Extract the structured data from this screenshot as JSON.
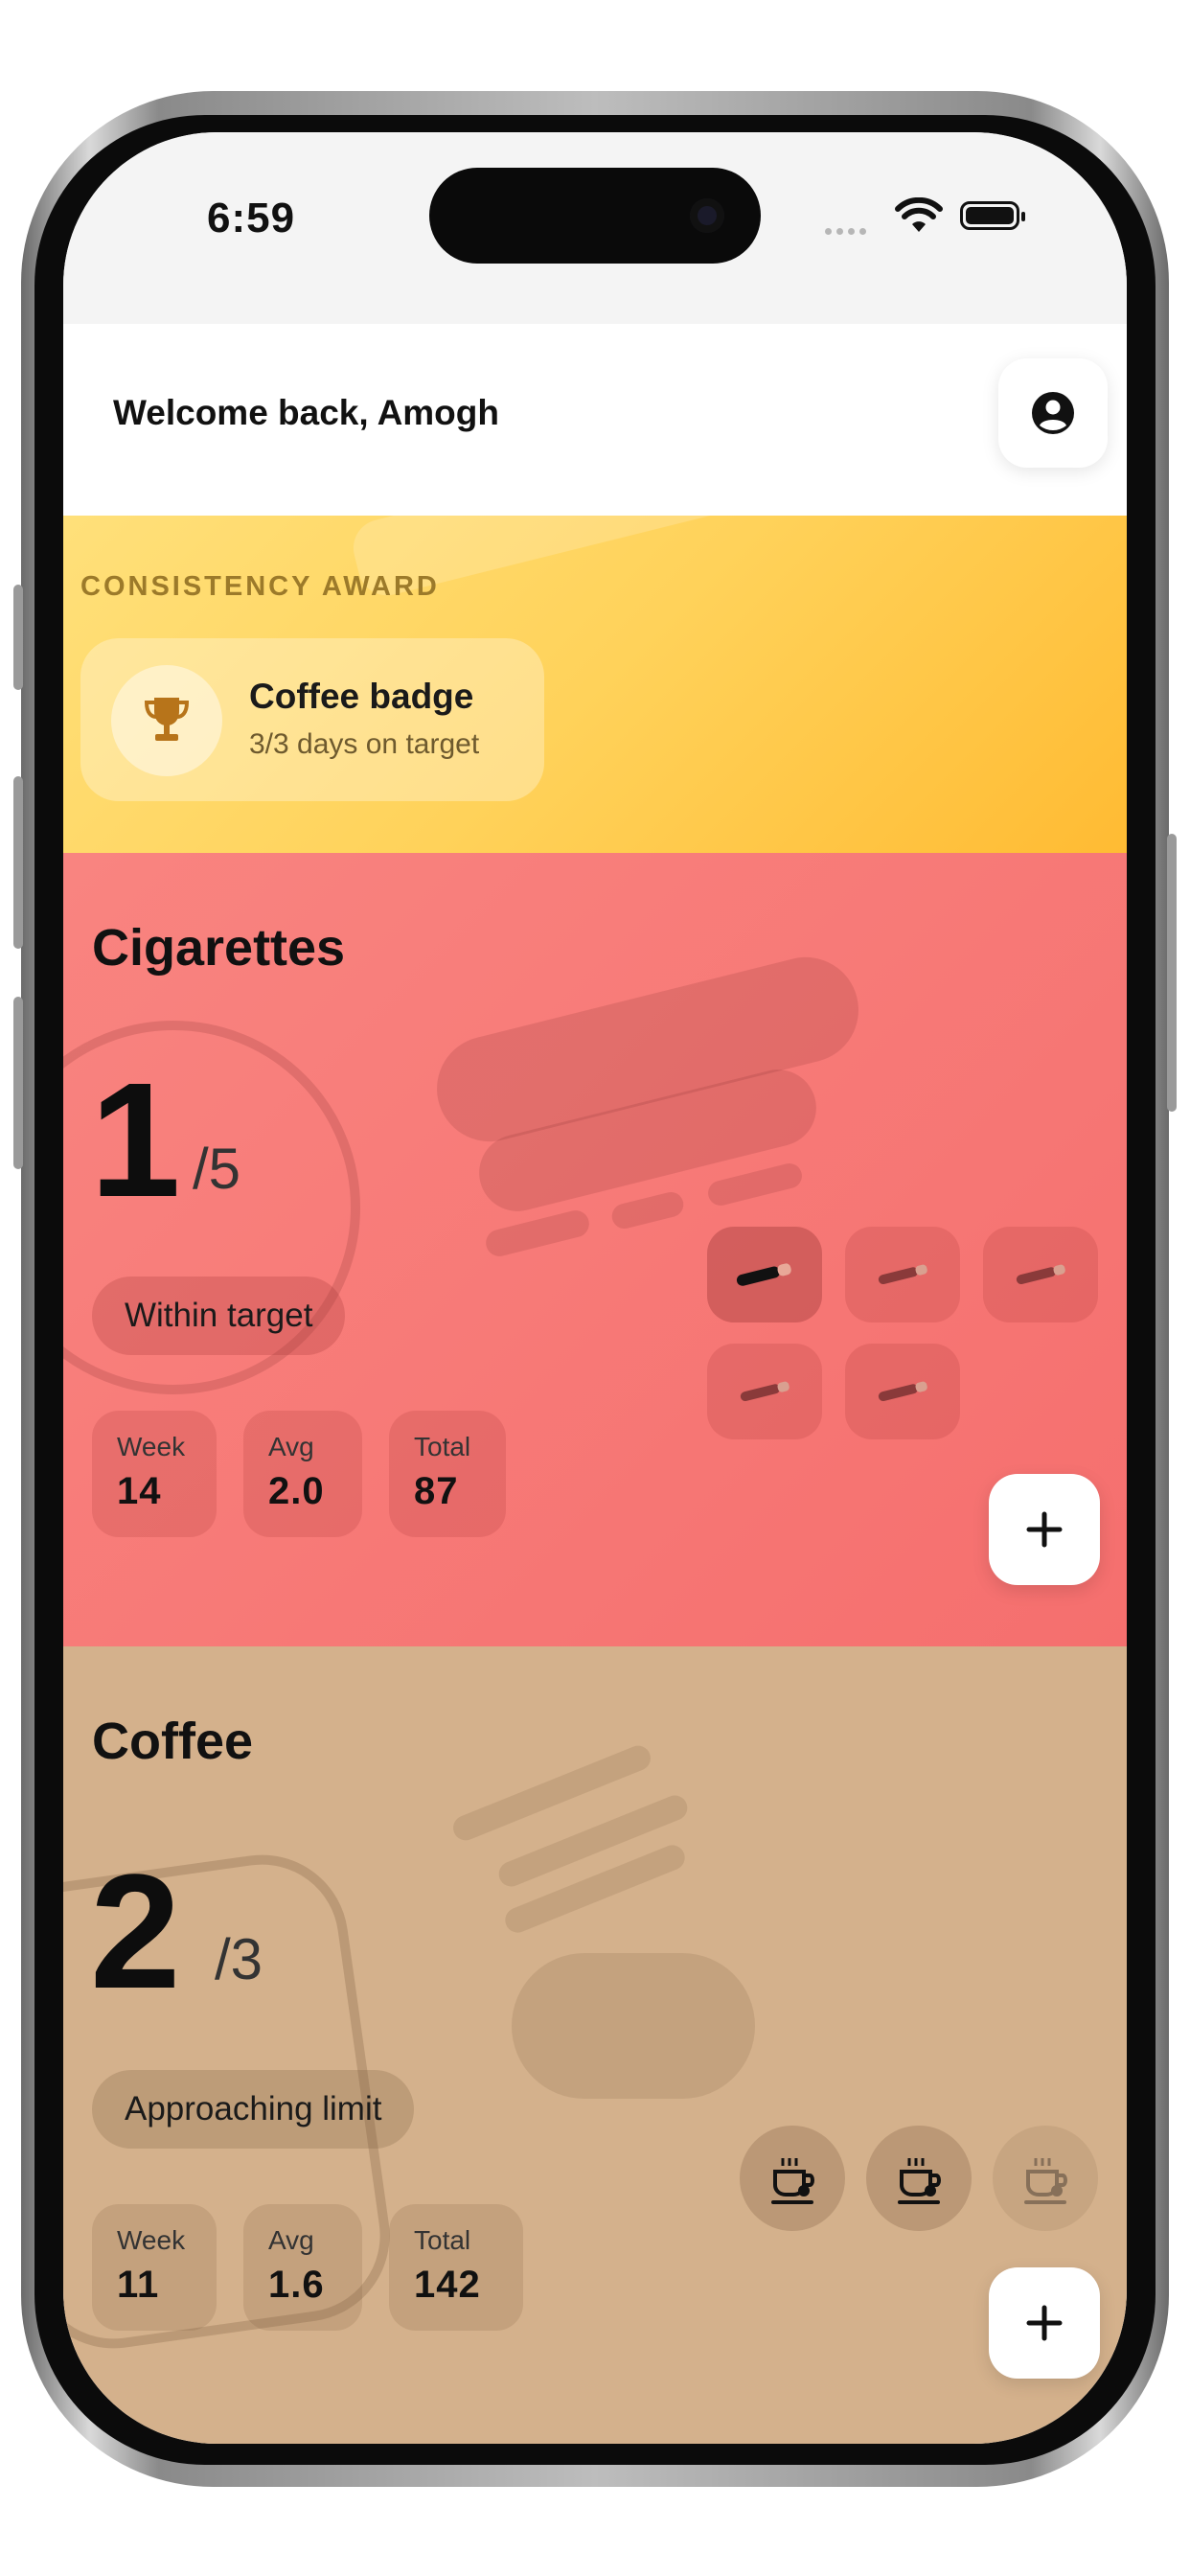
{
  "status_bar": {
    "time": "6:59"
  },
  "header": {
    "greeting": "Welcome back, Amogh",
    "profile_icon": "user-circle-icon"
  },
  "award": {
    "section_title": "CONSISTENCY AWARD",
    "badge_name": "Coffee badge",
    "badge_progress": "3/3 days on target",
    "icon": "trophy-icon"
  },
  "trackers": {
    "cigarettes": {
      "title": "Cigarettes",
      "count": "1",
      "limit": "/5",
      "status": "Within target",
      "stats": [
        {
          "label": "Week",
          "value": "14"
        },
        {
          "label": "Avg",
          "value": "2.0"
        },
        {
          "label": "Total",
          "value": "87"
        }
      ],
      "units_logged": 1,
      "units_limit": 5,
      "unit_icon": "cigarette-icon",
      "add_icon": "plus-icon"
    },
    "coffee": {
      "title": "Coffee",
      "count": "2",
      "limit": "/3",
      "status": "Approaching limit",
      "stats": [
        {
          "label": "Week",
          "value": "11"
        },
        {
          "label": "Avg",
          "value": "1.6"
        },
        {
          "label": "Total",
          "value": "142"
        }
      ],
      "units_logged": 2,
      "units_limit": 3,
      "unit_icon": "coffee-cup-icon",
      "add_icon": "plus-icon"
    }
  },
  "colors": {
    "award_gradient_start": "#ffe07a",
    "award_gradient_end": "#ffbb33",
    "cigarettes_bg": "#f67776",
    "coffee_bg": "#d4b18c"
  }
}
